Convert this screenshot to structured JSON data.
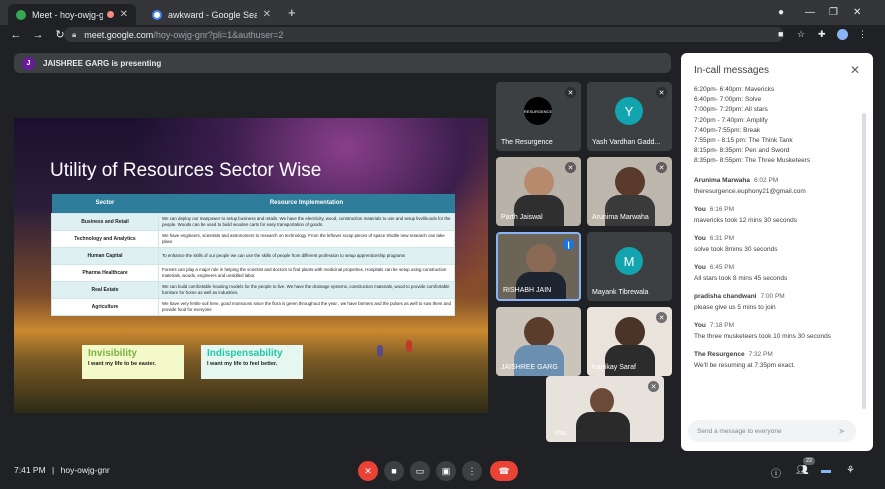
{
  "browser": {
    "tabs": [
      {
        "label": "Meet - hoy-owjg-gnr",
        "active": true
      },
      {
        "label": "awkward - Google Search",
        "active": false
      }
    ],
    "new_tab": "+",
    "url_host": "meet.google.com",
    "url_path": "/hoy-owjg-gnr?pli=1&authuser=2"
  },
  "presenter_bar": {
    "avatar": "J",
    "text": "JAISHREE GARG is presenting"
  },
  "slide": {
    "title": "Utility of Resources Sector Wise",
    "table_headers": [
      "Sector",
      "Resource Implementation"
    ],
    "rows": [
      {
        "sector": "Business and Retail",
        "text": "We can deploy our manpower to setup business and retails. We have the electricity, wood, construction materials to use and setup livelihoods for the people. Woods can be used to build wooden carts for easy transportation of goods."
      },
      {
        "sector": "Technology and Analytics",
        "text": "We have engineers, scientists and astronomers to research on technology. From the leftover scrap pieces of space shuttle new research can take place"
      },
      {
        "sector": "Human Capital",
        "text": "To enhance the skills of our people we can use the skills of people from different profession to setup apprenticeship programs"
      },
      {
        "sector": "Pharma Healthcare",
        "text": "Forests can play a major role in helping the scientist and doctors to find plants with medicinal properties. Hospitals can be setup using construction materials, woods, engineers and unskilled labor."
      },
      {
        "sector": "Real Estate",
        "text": "We can build comfortable housing models for the people to live. We have the drainage systems, construction materials, wood to provide comfortable furniture for home as well as industries."
      },
      {
        "sector": "Agriculture",
        "text": "We have very fertile soil here, good monsoons since the flora is green throughout the year , we have farmers and the pulses as well to sow them and provide food for everyone"
      }
    ],
    "cards": [
      {
        "title": "Invisibility",
        "sub": "I want my life to be easier."
      },
      {
        "title": "Indispensability",
        "sub": "I want my life to feel better."
      }
    ]
  },
  "participants": [
    {
      "name": "The Resurgence",
      "logo": "RESURGENCE"
    },
    {
      "name": "Yash Vardhan Gadd...",
      "letter": "Y"
    },
    {
      "name": "Parth Jaiswal"
    },
    {
      "name": "Arunima Marwaha"
    },
    {
      "name": "RISHABH JAIN"
    },
    {
      "name": "Mayank Tibrewala",
      "letter": "M"
    },
    {
      "name": "JAISHREE GARG"
    },
    {
      "name": "Kartikay Saraf"
    }
  ],
  "self_view": {
    "label": "You"
  },
  "chat": {
    "title": "In-call messages",
    "schedule": "6:20pm- 6:40pm: Mavericks\n6:40pm- 7:00pm: Solve\n7:00pm- 7:20pm: All stars\n7:20pm - 7:40pm: Amplify\n7:40pm-7:55pm: Break\n7:55pm - 8:15 pm: The Think Tank\n8:15pm- 8:35pm: Pen and Sword\n8:35pm- 8:55pm: The Three Musketeers",
    "messages": [
      {
        "from": "Arunima Marwaha",
        "time": "6:02 PM",
        "text": "theresurgence.euphony21@gmail.com"
      },
      {
        "from": "You",
        "time": "6:16 PM",
        "text": "mavericks took 12 mins 30 seconds"
      },
      {
        "from": "You",
        "time": "6:31 PM",
        "text": "solve took 8mins 30 seconds"
      },
      {
        "from": "You",
        "time": "6:45 PM",
        "text": "All stars took 8 mins 45 seconds"
      },
      {
        "from": "pradisha chandwani",
        "time": "7:00 PM",
        "text": "please give us 5 mins to join"
      },
      {
        "from": "You",
        "time": "7:18 PM",
        "text": "The three musketeers took 10 mins 30 seconds"
      },
      {
        "from": "The Resurgence",
        "time": "7:32 PM",
        "text": "We'll be resuming at 7:35pm exact."
      }
    ],
    "placeholder": "Send a message to everyone"
  },
  "bottom": {
    "time": "7:41 PM",
    "separator": "|",
    "meeting_code": "hoy-owjg-gnr",
    "participant_count": "22"
  }
}
